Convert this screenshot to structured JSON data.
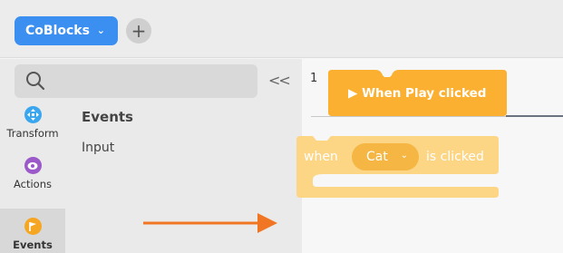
{
  "topbar": {
    "project_label": "CoBlocks",
    "project_chevron": "⌄",
    "add_label": "+"
  },
  "sidebar": {
    "search_icon": "search-icon",
    "collapse_label": "<<",
    "categories": [
      {
        "label": "Transform",
        "icon": "move-icon",
        "color": "#3ba6f0"
      },
      {
        "label": "Actions",
        "icon": "eye-icon",
        "color": "#9b59c9"
      },
      {
        "label": "Events",
        "icon": "flag-icon",
        "color": "#f5a623"
      }
    ],
    "group_title": "Events",
    "group_item": "Input"
  },
  "workspace": {
    "line_number": "1",
    "hat_block_label": "▶ When Play clicked",
    "ghost_block": {
      "when": "when",
      "sprite": "Cat",
      "chevron": "⌄",
      "clicked": "is clicked"
    },
    "colors": {
      "event_block": "#fbb031",
      "ghost_block": "#fcd585",
      "arrow": "#f07623"
    }
  }
}
